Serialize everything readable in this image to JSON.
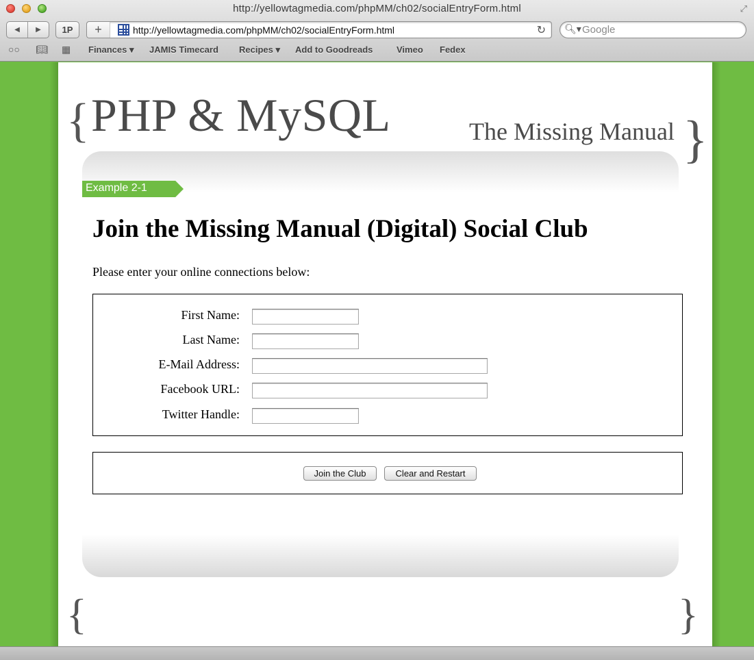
{
  "window": {
    "title": "http://yellowtagmedia.com/phpMM/ch02/socialEntryForm.html"
  },
  "toolbar": {
    "back_icon": "back-arrow-icon",
    "forward_icon": "forward-arrow-icon",
    "onepassword_label": "1P",
    "new_tab_label": "+",
    "address": "http://yellowtagmedia.com/phpMM/ch02/socialEntryForm.html",
    "search_placeholder": "Google"
  },
  "bookmarks": {
    "items": [
      {
        "label": "Finances ▾"
      },
      {
        "label": "JAMIS Timecard"
      },
      {
        "label": "Recipes ▾"
      },
      {
        "label": "Add to Goodreads"
      },
      {
        "label": "Vimeo"
      },
      {
        "label": "Fedex"
      }
    ]
  },
  "header": {
    "brace_open": "{",
    "title": "PHP & MySQL",
    "subtitle": "The Missing Manual",
    "brace_close": "}"
  },
  "main": {
    "example_tag": "Example 2-1",
    "heading": "Join the Missing Manual (Digital) Social Club",
    "intro": "Please enter your online connections below:",
    "fields": [
      {
        "label": "First Name:",
        "value": ""
      },
      {
        "label": "Last Name:",
        "value": ""
      },
      {
        "label": "E-Mail Address:",
        "value": ""
      },
      {
        "label": "Facebook URL:",
        "value": ""
      },
      {
        "label": "Twitter Handle:",
        "value": ""
      }
    ],
    "submit_label": "Join the Club",
    "reset_label": "Clear and Restart"
  },
  "footer": {
    "brace_open": "{",
    "brace_close": "}"
  },
  "colors": {
    "brand_green": "#6fbc43",
    "text_gray": "#4a4a4a"
  }
}
